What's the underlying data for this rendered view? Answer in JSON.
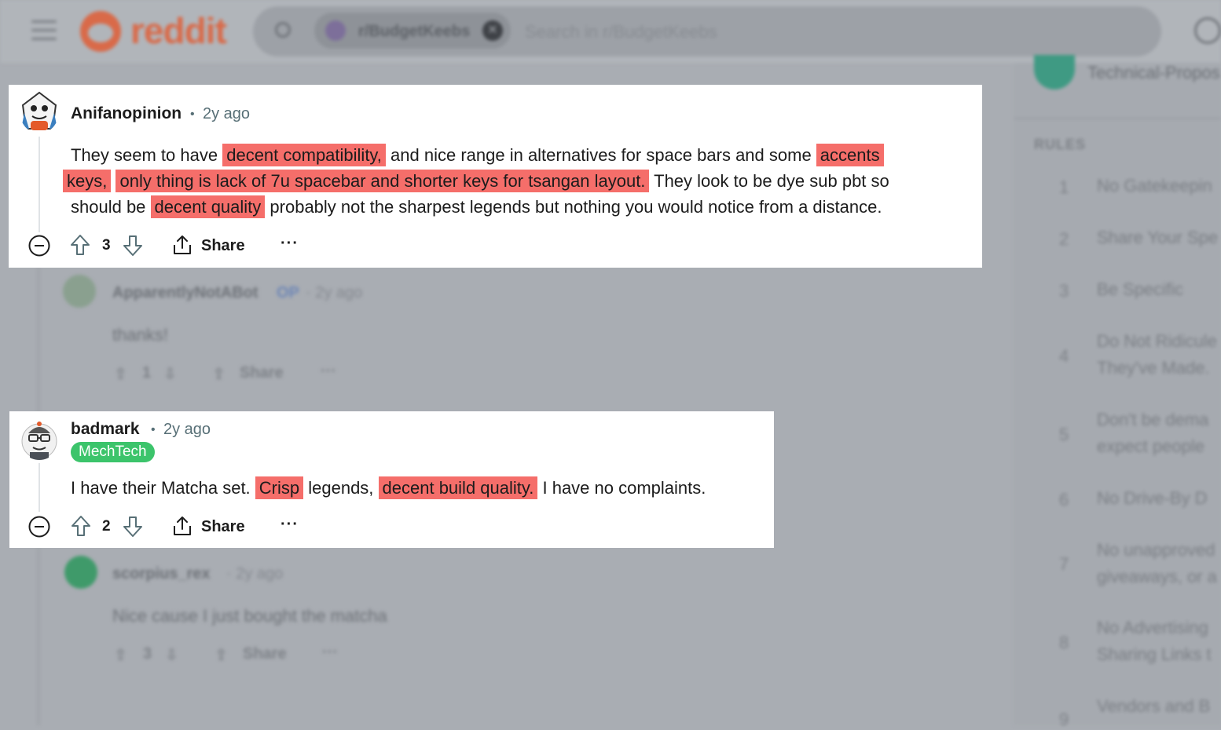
{
  "header": {
    "logo_text": "reddit",
    "search_chip": "r/BudgetKeebs",
    "search_placeholder": "Search in r/BudgetKeebs"
  },
  "sidebar": {
    "top_text": "Technical-Propos",
    "rules_header": "RULES",
    "rules": [
      {
        "num": "1",
        "text": "No Gatekeepin"
      },
      {
        "num": "2",
        "text": "Share Your Spe"
      },
      {
        "num": "3",
        "text": "Be Specific"
      },
      {
        "num": "4",
        "text": "Do Not Ridicule",
        "text2": "They've Made."
      },
      {
        "num": "5",
        "text": "Don't be dema",
        "text2": "expect people"
      },
      {
        "num": "6",
        "text": "No Drive-By D"
      },
      {
        "num": "7",
        "text": "No unapproved",
        "text2": "giveaways, or a"
      },
      {
        "num": "8",
        "text": "No Advertising",
        "text2": "Sharing Links t"
      },
      {
        "num": "9",
        "text": "Vendors and B"
      }
    ]
  },
  "background_replies": [
    {
      "user": "ApparentlyNotABot",
      "op_tag": "OP",
      "time": "· 2y ago",
      "body": "thanks!",
      "votes": "1",
      "share": "Share",
      "more": "···"
    },
    {
      "user": "scorpius_rex",
      "time": "· 2y ago",
      "body": "Nice cause I just bought the matcha",
      "votes": "3",
      "share": "Share",
      "more": "···"
    }
  ],
  "comments": [
    {
      "user": "Anifanopinion",
      "time": "2y ago",
      "line1": [
        {
          "t": "They seem to have ",
          "hl": false
        },
        {
          "t": "decent compatibility,",
          "hl": true
        },
        {
          "t": " and nice range in alternatives for space bars and some ",
          "hl": false
        },
        {
          "t": "accents",
          "hl": true
        }
      ],
      "line2": [
        {
          "t": "keys,",
          "hl": true
        },
        {
          "t": " ",
          "hl": false
        },
        {
          "t": "only thing is lack of 7u spacebar and shorter keys for tsangan layout.",
          "hl": true
        },
        {
          "t": " They look to be dye sub pbt so",
          "hl": false
        }
      ],
      "line3": [
        {
          "t": "should be ",
          "hl": false
        },
        {
          "t": "decent quality",
          "hl": true
        },
        {
          "t": " probably not the sharpest legends but nothing you would notice from a distance.",
          "hl": false
        }
      ],
      "votes": "3",
      "share": "Share",
      "more": "···"
    },
    {
      "user": "badmark",
      "time": "2y ago",
      "flair": "MechTech",
      "line1": [
        {
          "t": "I have their Matcha set. ",
          "hl": false
        },
        {
          "t": "Crisp",
          "hl": true
        },
        {
          "t": " legends, ",
          "hl": false
        },
        {
          "t": "decent build quality.",
          "hl": true
        },
        {
          "t": " I have no complaints.",
          "hl": false
        }
      ],
      "votes": "2",
      "share": "Share",
      "more": "···"
    }
  ],
  "colors": {
    "highlight": "#f56e6a",
    "flair": "#3cc46b",
    "brand": "#ff4500",
    "overlay": "#a9adb3"
  },
  "icons": [
    "menu-icon",
    "reddit-logo-icon",
    "search-icon",
    "close-icon",
    "chat-icon",
    "collapse-icon",
    "upvote-icon",
    "downvote-icon",
    "share-icon",
    "more-icon"
  ]
}
